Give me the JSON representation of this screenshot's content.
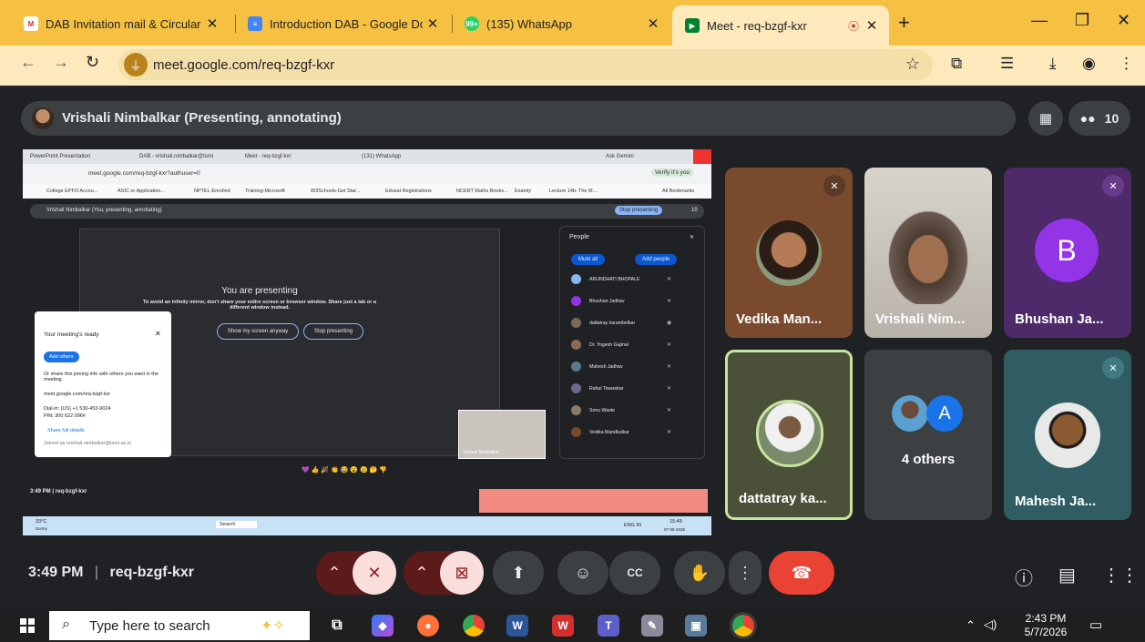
{
  "browser": {
    "tabs": [
      {
        "title": "DAB Invitation mail & Circular -",
        "icon": "gmail-icon",
        "color": "#d93025"
      },
      {
        "title": "Introduction DAB - Google Doc",
        "icon": "docs-icon",
        "color": "#4285f4"
      },
      {
        "title": "(135) WhatsApp",
        "icon": "whatsapp-icon",
        "color": "#25d366",
        "badge": "99+"
      },
      {
        "title": "Meet - req-bzgf-kxr",
        "icon": "meet-icon",
        "color": "#00832d"
      }
    ],
    "new_tab": "+",
    "url": "meet.google.com/req-bzgf-kxr"
  },
  "meet": {
    "presenter_bar": "Vrishali Nimbalkar (Presenting, annotating)",
    "participant_count": "10",
    "meeting_time": "3:49 PM",
    "meeting_code": "req-bzgf-kxr",
    "tiles": [
      {
        "name": "Vedika Man...",
        "muted": true,
        "bg": "#7a4a2e"
      },
      {
        "name": "Vrishali Nim...",
        "muted": false,
        "bg": "#c9c4bd"
      },
      {
        "name": "Bhushan Ja...",
        "muted": true,
        "bg": "#4e2a6a",
        "letter": "B"
      },
      {
        "name": "dattatray ka...",
        "muted": false,
        "bg": "#4a5138"
      },
      {
        "name": "4 others",
        "muted": false,
        "bg": "#3c4043",
        "letter": "A"
      },
      {
        "name": "Mahesh Ja...",
        "muted": true,
        "bg": "#2f5d63"
      }
    ]
  },
  "shared_screen": {
    "tabs": [
      "PowerPoint Presentation",
      "DAB - vrishali.nimbalkar@tsmi",
      "Meet - req-bzgf-kxr",
      "(131) WhatsApp",
      "Ask Gemini"
    ],
    "url": "meet.google.com/req-bzgf-kxr?authuser=0",
    "verify": "Verify it's you",
    "bookmarks": [
      "College EPFO Accou...",
      "ASIC or Application...",
      "NPTEL-Enrolled",
      "Training-Microsoft",
      "W3Schools-Get Star...",
      "Edusat Registrations",
      "NCERT Maths Books...",
      "Examly",
      "Lecture 14b: The M...",
      "All Bookmarks"
    ],
    "presenter_bar": "Vrishali Nimbalkar (You, presenting, annotating)",
    "stop_presenting": "Stop presenting",
    "count": "10",
    "presenting_title": "You are presenting",
    "presenting_msg": "To avoid an infinity mirror, don't share your entire screen or browser window. Share just a tab or a different window instead.",
    "show_anyway": "Show my screen anyway",
    "stop_btn": "Stop presenting",
    "ready_title": "Your meeting's ready",
    "add_others": "Add others",
    "ready_msg": "Or share this joining info with others you want in the meeting",
    "ready_link": "meet.google.com/req-bzgf-kxr",
    "dial_in": "Dial-in: (US) +1 530-453-9024",
    "pin": "PIN: 300 622 096#",
    "share_details": "Share full details",
    "joined_as": "Joined as vrishali.nimbalkar@tsmi.ac.in",
    "people_title": "People",
    "mute_all": "Mute all",
    "add_people": "Add people",
    "people": [
      "ARUNDHATI BHOPALE",
      "Bhushan Jadhav",
      "dattatray karambelkar",
      "Dr. Yogesh Gajmal",
      "Mahesh Jadhav",
      "Rahul Tiwarekar",
      "Sonu Waste",
      "Vedika Mandkulkar"
    ],
    "self_view": "Vrishali Nimbalkar",
    "time": "3:49 PM",
    "code": "req-bzgf-kxr",
    "weather": "33°C",
    "weather_sub": "Sunny",
    "search": "Search",
    "lang": "ENG IN",
    "clock": "15:49",
    "date": "07-05-2026"
  },
  "taskbar": {
    "search_placeholder": "Type here to search",
    "time": "2:43 PM",
    "date": "5/7/2026"
  }
}
